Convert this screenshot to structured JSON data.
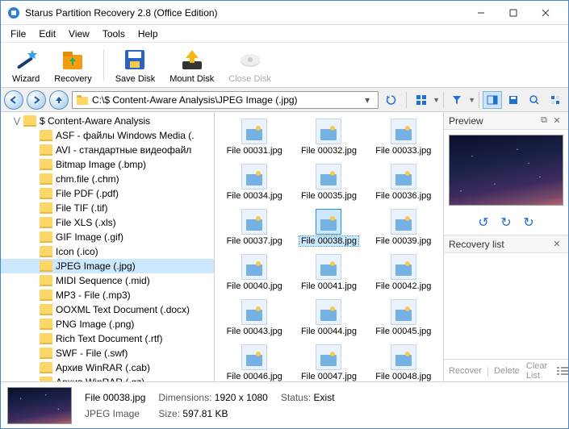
{
  "window": {
    "title": "Starus Partition Recovery 2.8 (Office Edition)"
  },
  "menu": {
    "file": "File",
    "edit": "Edit",
    "view": "View",
    "tools": "Tools",
    "help": "Help"
  },
  "toolbar": {
    "wizard": "Wizard",
    "recovery": "Recovery",
    "savedisk": "Save Disk",
    "mountdisk": "Mount Disk",
    "closedisk": "Close Disk"
  },
  "address": {
    "path": "C:\\$ Content-Aware Analysis\\JPEG Image (.jpg)"
  },
  "tree": {
    "root": "$ Content-Aware Analysis",
    "items": [
      "ASF - файлы Windows Media (.",
      "AVI - стандартные видеофайл",
      "Bitmap Image (.bmp)",
      "chm.file (.chm)",
      "File PDF (.pdf)",
      "File TIF (.tif)",
      "File XLS (.xls)",
      "GIF Image (.gif)",
      "Icon (.ico)",
      "JPEG Image (.jpg)",
      "MIDI Sequence (.mid)",
      "MP3 - File (.mp3)",
      "OOXML Text Document (.docx)",
      "PNG Image (.png)",
      "Rich Text Document (.rtf)",
      "SWF - File (.swf)",
      "Архив WinRAR (.cab)",
      "Архив WinRAR (.gz)"
    ],
    "selected": 9
  },
  "files": {
    "items": [
      "File 00031.jpg",
      "File 00032.jpg",
      "File 00033.jpg",
      "File 00034.jpg",
      "File 00035.jpg",
      "File 00036.jpg",
      "File 00037.jpg",
      "File 00038.jpg",
      "File 00039.jpg",
      "File 00040.jpg",
      "File 00041.jpg",
      "File 00042.jpg",
      "File 00043.jpg",
      "File 00044.jpg",
      "File 00045.jpg",
      "File 00046.jpg",
      "File 00047.jpg",
      "File 00048.jpg"
    ],
    "selected": 7
  },
  "right": {
    "preview": "Preview",
    "reclist": "Recovery list",
    "recover": "Recover",
    "delete": "Delete",
    "clear": "Clear List"
  },
  "status": {
    "filename": "File 00038.jpg",
    "filetype": "JPEG Image",
    "dim_label": "Dimensions:",
    "dim_val": "1920 x 1080",
    "size_label": "Size:",
    "size_val": "597.81 KB",
    "stat_label": "Status:",
    "stat_val": "Exist"
  }
}
